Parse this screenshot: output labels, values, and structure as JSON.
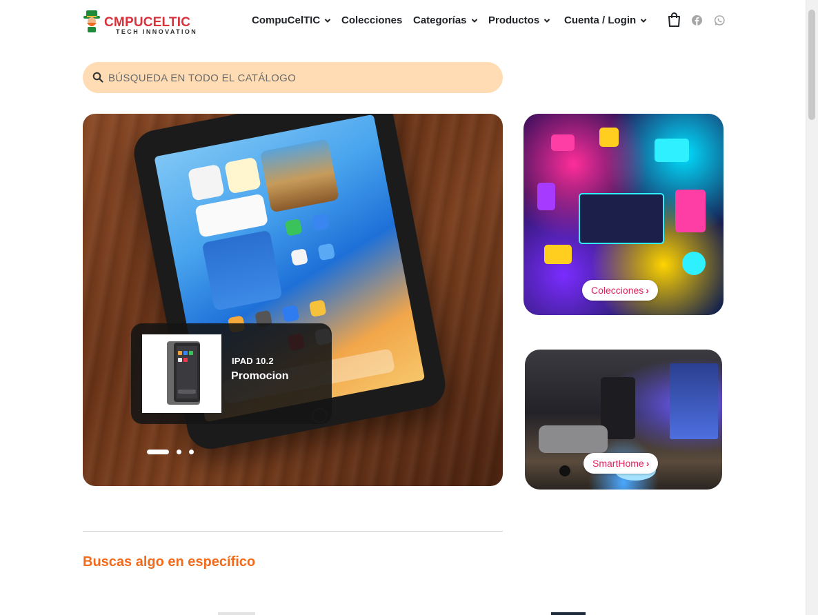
{
  "brand": {
    "name": "CMPUCELTIC",
    "tagline": "TECH INNOVATION",
    "colors": {
      "logo_red": "#d8323b",
      "accent_orange": "#f26a1b",
      "search_bg": "#ffdcb3",
      "pill_text": "#e0245e"
    }
  },
  "nav": {
    "items": [
      {
        "label": "CompuCelTIC",
        "has_dropdown": true
      },
      {
        "label": "Colecciones",
        "has_dropdown": false
      },
      {
        "label": "Categorías",
        "has_dropdown": true
      },
      {
        "label": "Productos",
        "has_dropdown": true
      },
      {
        "label": "Cuenta / Login",
        "has_dropdown": true
      }
    ],
    "icons": [
      "shopping-bag-icon",
      "facebook-icon",
      "whatsapp-icon"
    ]
  },
  "search": {
    "placeholder": "BÚSQUEDA EN TODO EL CATÁLOGO",
    "value": ""
  },
  "hero": {
    "slide": {
      "label": "IPAD 10.2",
      "title": "Promocion"
    },
    "slides_count": 3,
    "active_slide": 1
  },
  "cards": [
    {
      "label": "Colecciones",
      "icon": "chevron-right-icon"
    },
    {
      "label": "SmartHome",
      "icon": "chevron-right-icon"
    }
  ],
  "section": {
    "title": "Buscas algo en específico"
  }
}
